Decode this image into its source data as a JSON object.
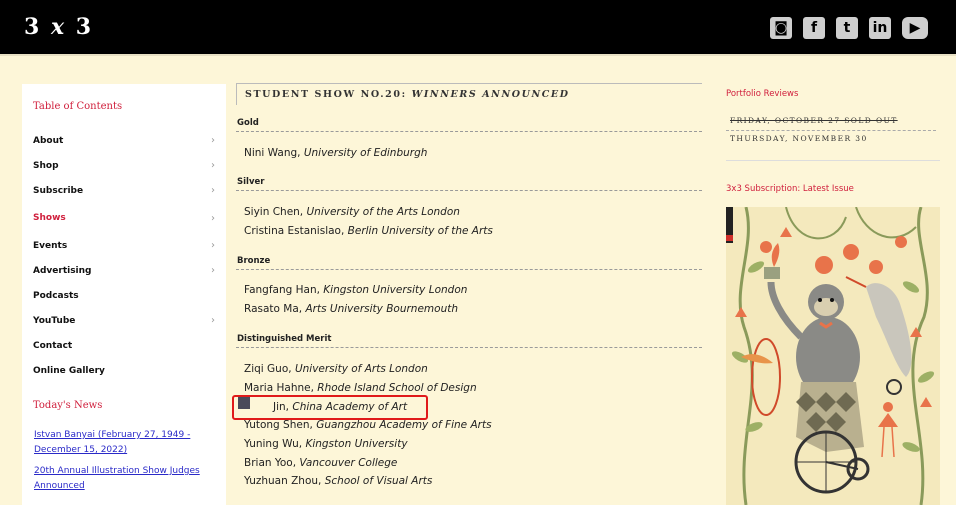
{
  "header": {
    "logo": {
      "a": "3",
      "x": "x",
      "b": "3"
    },
    "social": [
      {
        "name": "instagram-icon",
        "glyph": "◙"
      },
      {
        "name": "facebook-icon",
        "glyph": "f"
      },
      {
        "name": "tumblr-icon",
        "glyph": "t"
      },
      {
        "name": "linkedin-icon",
        "glyph": "in"
      },
      {
        "name": "youtube-icon",
        "glyph": "▶"
      }
    ]
  },
  "sidebar": {
    "toc_title": "Table of Contents",
    "items": [
      {
        "label": "About",
        "chev": "›"
      },
      {
        "label": "Shop",
        "chev": "›"
      },
      {
        "label": "Subscribe",
        "chev": "›"
      },
      {
        "label": "Shows",
        "chev": "›"
      },
      {
        "label": "Events",
        "chev": "›"
      },
      {
        "label": "Advertising",
        "chev": "›"
      },
      {
        "label": "Podcasts",
        "chev": ""
      },
      {
        "label": "YouTube",
        "chev": "›"
      },
      {
        "label": "Contact",
        "chev": ""
      },
      {
        "label": "Online Gallery",
        "chev": ""
      }
    ],
    "news_title": "Today's News",
    "news": [
      "Istvan Banyai (February 27, 1949 - December 15, 2022)",
      "20th Annual Illustration Show Judges Announced"
    ]
  },
  "main": {
    "title_a": "STUDENT SHOW NO.20:",
    "title_b": "WINNERS ANNOUNCED",
    "categories": {
      "gold": "Gold",
      "silver": "Silver",
      "bronze": "Bronze",
      "merit": "Distinguished Merit"
    },
    "gold": [
      {
        "name": "Nini Wang,",
        "school": "University of Edinburgh"
      }
    ],
    "silver": [
      {
        "name": "Siyin Chen,",
        "school": "University of the Arts London"
      },
      {
        "name": "Cristina Estanislao,",
        "school": "Berlin University of the Arts"
      }
    ],
    "bronze": [
      {
        "name": "Fangfang Han,",
        "school": "Kingston University London"
      },
      {
        "name": "Rasato Ma,",
        "school": "Arts University Bournemouth"
      }
    ],
    "merit": [
      {
        "name": "Ziqi Guo,",
        "school": "University of Arts London"
      },
      {
        "name": "Maria Hahne,",
        "school": "Rhode Island School of Design"
      },
      {
        "name": "Jin,",
        "school": "China Academy of Art"
      },
      {
        "name": "Yutong Shen,",
        "school": "Guangzhou Academy of Fine Arts"
      },
      {
        "name": "Yuning Wu,",
        "school": "Kingston University"
      },
      {
        "name": "Brian Yoo,",
        "school": "Vancouver College"
      },
      {
        "name": "Yuzhuan Zhou,",
        "school": "School of Visual Arts"
      }
    ]
  },
  "right": {
    "portfolio_title": "Portfolio Reviews",
    "line1": "FRIDAY, OCTOBER 27 SOLD OUT",
    "line2": "THURSDAY, NOVEMBER 30",
    "subscription_title": "3x3 Subscription: Latest Issue"
  },
  "colors": {
    "accent": "#d01f3c",
    "highlight": "#e01a1a",
    "page_bg": "#fdf6d8"
  }
}
